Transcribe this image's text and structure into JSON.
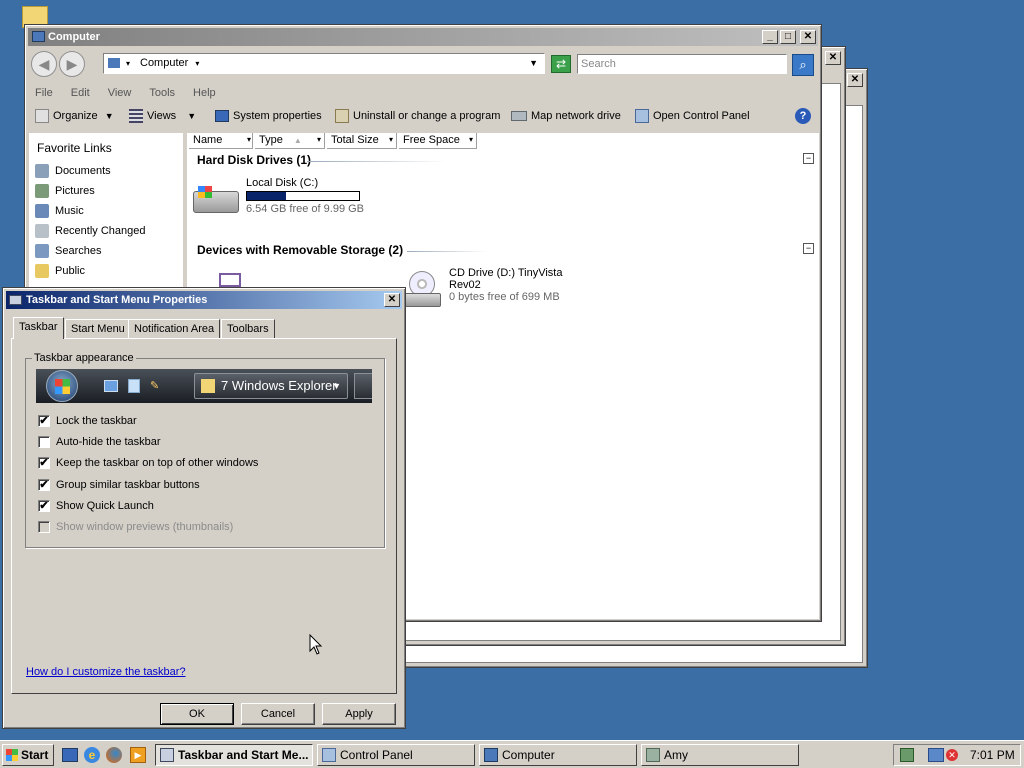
{
  "explorer": {
    "title": "Computer",
    "address": "Computer",
    "search_placeholder": "Search",
    "menu": [
      "File",
      "Edit",
      "View",
      "Tools",
      "Help"
    ],
    "toolbar": {
      "organize": "Organize",
      "views": "Views",
      "system_properties": "System properties",
      "uninstall": "Uninstall or change a program",
      "map_drive": "Map network drive",
      "control_panel": "Open Control Panel"
    },
    "favorites_title": "Favorite Links",
    "favorites": [
      "Documents",
      "Pictures",
      "Music",
      "Recently Changed",
      "Searches",
      "Public"
    ],
    "columns": [
      "Name",
      "Type",
      "Total Size",
      "Free Space"
    ],
    "groups": {
      "hard_disks": "Hard Disk Drives (1)",
      "removable": "Devices with Removable Storage (2)"
    },
    "local_disk": {
      "name": "Local Disk (C:)",
      "free_text": "6.54 GB free of 9.99 GB",
      "used_fraction": 0.35
    },
    "cd_drive": {
      "name": "CD Drive (D:) TinyVista",
      "name2": "Rev02",
      "free_text": "0 bytes free of 699 MB"
    }
  },
  "dialog": {
    "title": "Taskbar and Start Menu Properties",
    "tabs": [
      "Taskbar",
      "Start Menu",
      "Notification Area",
      "Toolbars"
    ],
    "group_label": "Taskbar appearance",
    "preview_button": "7 Windows Explorer",
    "options": [
      {
        "label": "Lock the taskbar",
        "checked": true,
        "enabled": true
      },
      {
        "label": "Auto-hide the taskbar",
        "checked": false,
        "enabled": true
      },
      {
        "label": "Keep the taskbar on top of other windows",
        "checked": true,
        "enabled": true
      },
      {
        "label": "Group similar taskbar buttons",
        "checked": true,
        "enabled": true
      },
      {
        "label": "Show Quick Launch",
        "checked": true,
        "enabled": true
      },
      {
        "label": "Show window previews (thumbnails)",
        "checked": false,
        "enabled": false
      }
    ],
    "help_link": "How do I customize the taskbar?",
    "ok": "OK",
    "cancel": "Cancel",
    "apply": "Apply"
  },
  "taskbar": {
    "start": "Start",
    "tasks": [
      "Taskbar and Start Me...",
      "Control Panel",
      "Computer",
      "Amy"
    ],
    "clock": "7:01 PM"
  },
  "colors": {
    "desktop": "#3a6ea5",
    "progress": "#0a246a",
    "link": "#0000cc"
  }
}
